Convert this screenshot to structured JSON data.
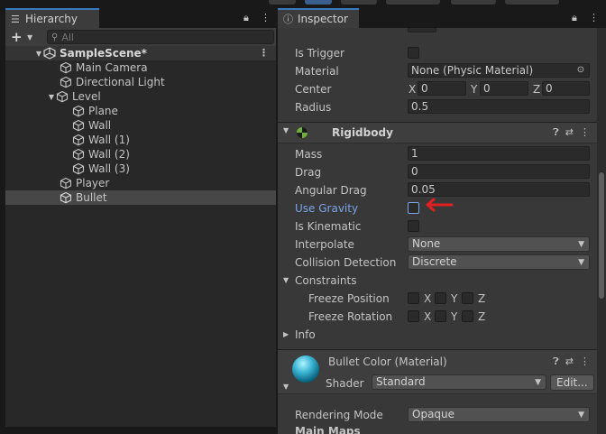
{
  "hierarchy": {
    "tab_label": "Hierarchy",
    "search_placeholder": "All",
    "scene_name": "SampleScene*",
    "items": [
      {
        "label": "Main Camera"
      },
      {
        "label": "Directional Light"
      },
      {
        "label": "Level"
      },
      {
        "label": "Plane"
      },
      {
        "label": "Wall"
      },
      {
        "label": "Wall (1)"
      },
      {
        "label": "Wall (2)"
      },
      {
        "label": "Wall (3)"
      },
      {
        "label": "Player"
      },
      {
        "label": "Bullet"
      }
    ],
    "selected_item": "Bullet"
  },
  "inspector": {
    "tab_label": "Inspector",
    "collider": {
      "is_trigger_label": "Is Trigger",
      "is_trigger": false,
      "material_label": "Material",
      "material_value": "None (Physic Material)",
      "center_label": "Center",
      "center": {
        "x_label": "X",
        "x": "0",
        "y_label": "Y",
        "y": "0",
        "z_label": "Z",
        "z": "0"
      },
      "radius_label": "Radius",
      "radius": "0.5"
    },
    "rigidbody": {
      "title": "Rigidbody",
      "mass_label": "Mass",
      "mass": "1",
      "drag_label": "Drag",
      "drag": "0",
      "angular_drag_label": "Angular Drag",
      "angular_drag": "0.05",
      "use_gravity_label": "Use Gravity",
      "use_gravity": false,
      "is_kinematic_label": "Is Kinematic",
      "is_kinematic": false,
      "interpolate_label": "Interpolate",
      "interpolate": "None",
      "collision_detection_label": "Collision Detection",
      "collision_detection": "Discrete",
      "constraints_label": "Constraints",
      "freeze_position_label": "Freeze Position",
      "freeze_rotation_label": "Freeze Rotation",
      "axes": [
        "X",
        "Y",
        "Z"
      ],
      "info_label": "Info"
    },
    "material": {
      "name": "Bullet Color (Material)",
      "shader_label": "Shader",
      "shader": "Standard",
      "edit_label": "Edit...",
      "rendering_mode_label": "Rendering Mode",
      "rendering_mode": "Opaque",
      "main_maps_label": "Main Maps"
    }
  },
  "colors": {
    "accent_blue": "#3a79bb",
    "active_label": "#7ba3e8",
    "annotation_red": "#e02020"
  }
}
